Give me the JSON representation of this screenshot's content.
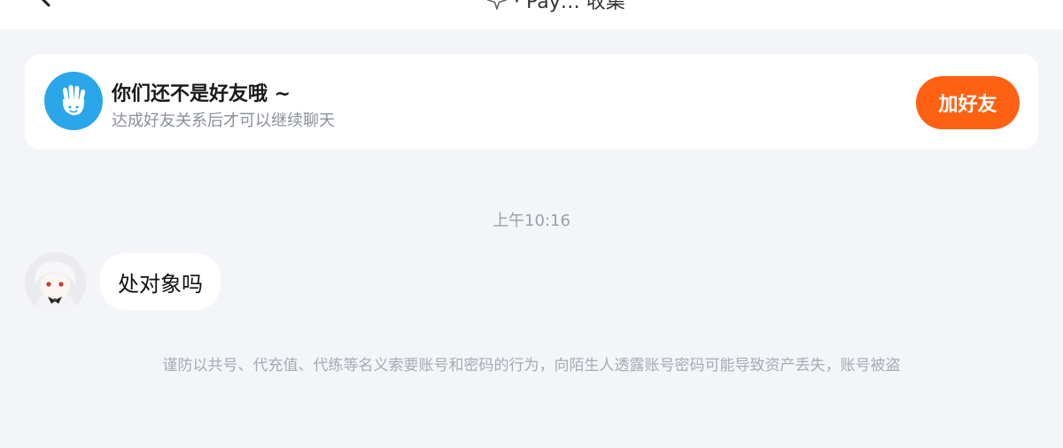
{
  "header": {
    "title": "· Pay… 收集",
    "back_icon": "back-arrow-icon",
    "title_icon": "sparkle-icon"
  },
  "friend_notice": {
    "icon": "hand-wave-icon",
    "title": "你们还不是好友哦 ~",
    "subtitle": "达成好友关系后才可以继续聊天",
    "add_button_label": "加好友",
    "accent_color": "#ff6113",
    "icon_color": "#2aa6ea"
  },
  "chat": {
    "timestamp": "上午10:16",
    "messages": [
      {
        "sender": "other",
        "text": "处对象吗"
      }
    ]
  },
  "security_notice": "谨防以共号、代充值、代练等名义索要账号和密码的行为，向陌生人透露账号密码可能导致资产丢失，账号被盗"
}
